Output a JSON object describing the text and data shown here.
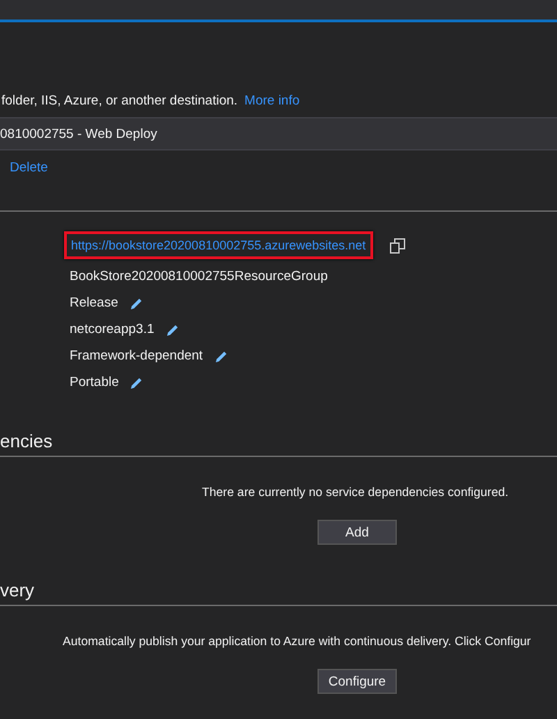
{
  "intro": {
    "text": "folder, IIS, Azure, or another destination.",
    "link": "More info"
  },
  "profile": {
    "name": "0810002755 - Web Deploy"
  },
  "profile_actions": [
    "Delete"
  ],
  "settings": [
    {
      "value": "https://bookstore20200810002755.azurewebsites.net",
      "kind": "link",
      "highlighted": true
    },
    {
      "value": "BookStore20200810002755ResourceGroup",
      "kind": "plain"
    },
    {
      "value": "Release",
      "kind": "editable"
    },
    {
      "value": "netcoreapp3.1",
      "kind": "editable"
    },
    {
      "value": "Framework-dependent",
      "kind": "editable"
    },
    {
      "value": "Portable",
      "kind": "editable"
    }
  ],
  "sections": [
    {
      "heading": "encies",
      "message": "There are currently no service dependencies configured.",
      "button": "Add"
    },
    {
      "heading": "very",
      "message": "Automatically publish your application to Azure with continuous delivery. Click Configur",
      "button": "Configure"
    }
  ]
}
